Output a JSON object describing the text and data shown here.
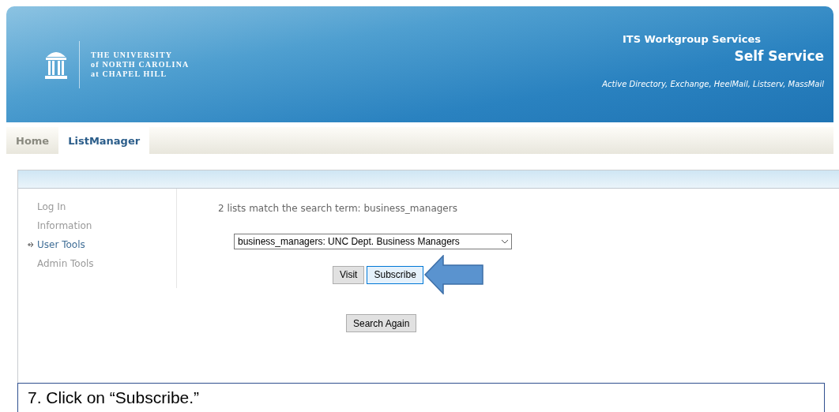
{
  "header": {
    "logo_lines": [
      "THE UNIVERSITY",
      "of NORTH CAROLINA",
      "at CHAPEL HILL"
    ],
    "service_group": "ITS Workgroup Services",
    "service_title": "Self Service",
    "services": "Active Directory, Exchange, HeelMail, Listserv, MassMail"
  },
  "tabs": [
    {
      "label": "Home",
      "selected": false
    },
    {
      "label": "ListManager",
      "selected": true
    }
  ],
  "sidebar": {
    "items": [
      {
        "label": "Log In",
        "selected": false
      },
      {
        "label": "Information",
        "selected": false
      },
      {
        "label": "User Tools",
        "selected": true
      },
      {
        "label": "Admin Tools",
        "selected": false
      }
    ]
  },
  "content": {
    "message": "2 lists match the search term: business_managers",
    "list_select": {
      "value": "business_managers: UNC Dept. Business Managers"
    },
    "buttons": [
      {
        "label": "Visit",
        "highlighted": false
      },
      {
        "label": "Subscribe",
        "highlighted": true
      }
    ],
    "search_again": "Search Again"
  },
  "callout": {
    "text": "7.  Click on “Subscribe.”"
  }
}
